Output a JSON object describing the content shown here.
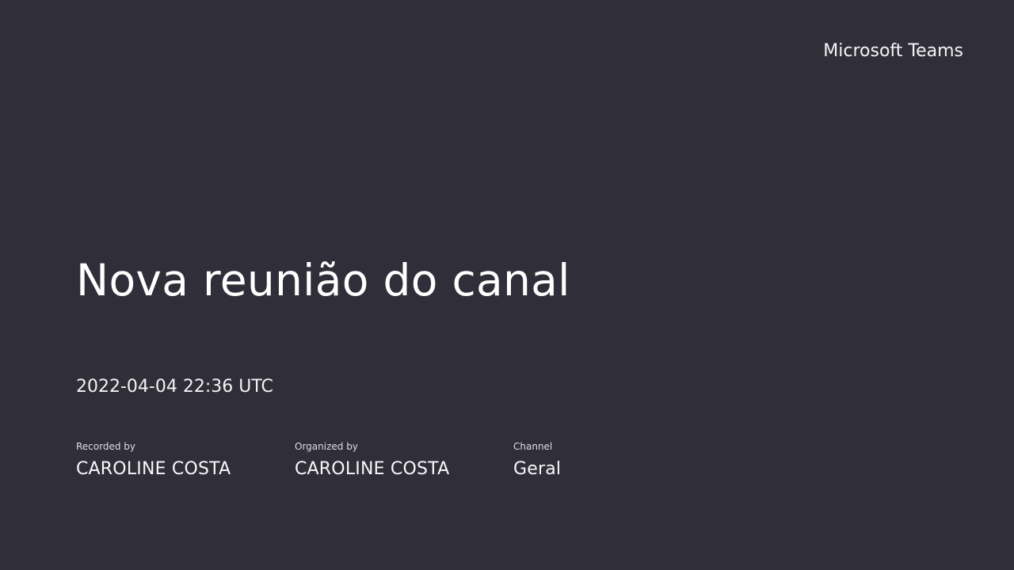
{
  "brand": {
    "name": "Microsoft Teams"
  },
  "meeting": {
    "title": "Nova reunião do canal",
    "datetime": "2022-04-04 22:36 UTC",
    "recorded_by": {
      "label": "Recorded by",
      "value": "CAROLINE COSTA"
    },
    "organized_by": {
      "label": "Organized by",
      "value": "CAROLINE COSTA"
    },
    "channel": {
      "label": "Channel",
      "value": "Geral"
    }
  },
  "colors": {
    "background": "#302f39",
    "text": "#ffffff"
  }
}
